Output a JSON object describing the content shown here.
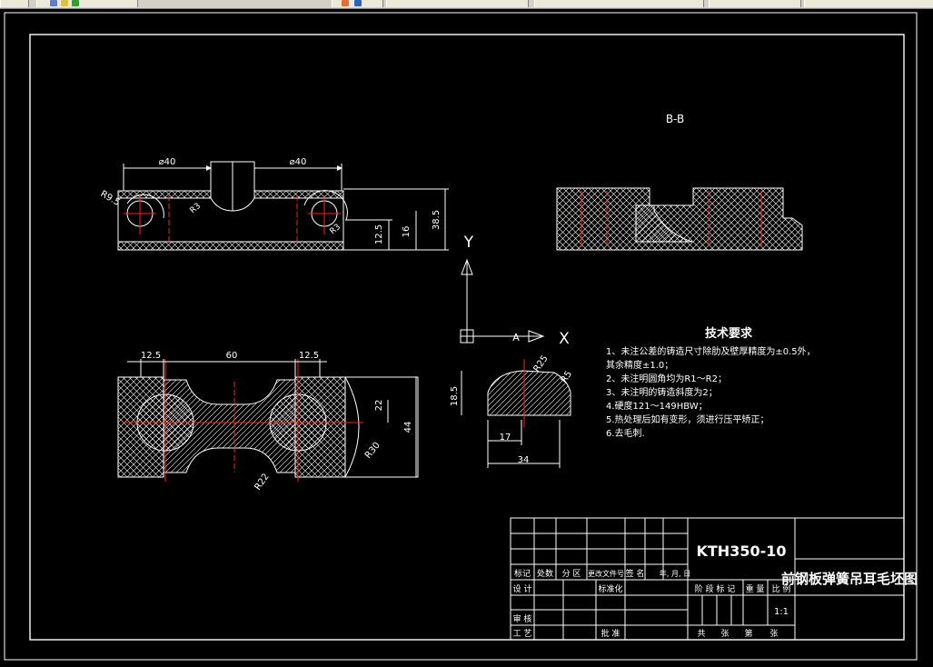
{
  "toolbar": {
    "icons": [
      "new-icon",
      "layer-icon",
      "properties-icon",
      "style-icon",
      "text-style-icon",
      "dimension-style-icon"
    ]
  },
  "drawing": {
    "section_label": "B-B",
    "axis_y": "Y",
    "axis_x": "X",
    "axis_a": "A",
    "dims_top": {
      "d1": "⌀40",
      "d2": "⌀40",
      "r1": "R9.5",
      "r2": "R3",
      "r3": "R3",
      "h1": "12.5",
      "h2": "16",
      "h3": "38.5"
    },
    "dims_plan": {
      "w1": "12.5",
      "w2": "60",
      "w3": "12.5",
      "h1": "22",
      "h2": "44",
      "r1": "R30",
      "r2": "R22"
    },
    "dims_small": {
      "h": "18.5",
      "w1": "17",
      "w2": "34",
      "r1": "R25",
      "r2": "R5"
    }
  },
  "notes": {
    "title": "技术要求",
    "lines": [
      "1、未注公差的铸造尺寸除肋及壁厚精度为±0.5外，",
      "其余精度±1.0；",
      "2、未注明圆角均为R1～R2；",
      "3、未注明的铸造斜度为2；",
      "4.硬度121～149HBW；",
      "5.热处理后如有变形，须进行压平矫正；",
      "6.去毛刺."
    ]
  },
  "titleblock": {
    "drawing_no": "KTH350-10",
    "part_name": "前钢板弹簧吊耳毛坯图",
    "scale": "1:1",
    "labels": {
      "biaoji": "标记",
      "chushu": "处数",
      "fenqu": "分 区",
      "gengwai": "更改文件号",
      "qianming": "签 名",
      "date": "年, 月, 日",
      "sheji": "设 计",
      "biaozhunhua": "标准化",
      "jieduan": "阶 段 标 记",
      "zhongliang": "重 量",
      "bili": "比 例",
      "shenhe": "审 核",
      "gongyi": "工 艺",
      "pizhun": "批 准",
      "gong": "共",
      "zhang": "张",
      "di": "第",
      "zhang2": "张"
    }
  }
}
